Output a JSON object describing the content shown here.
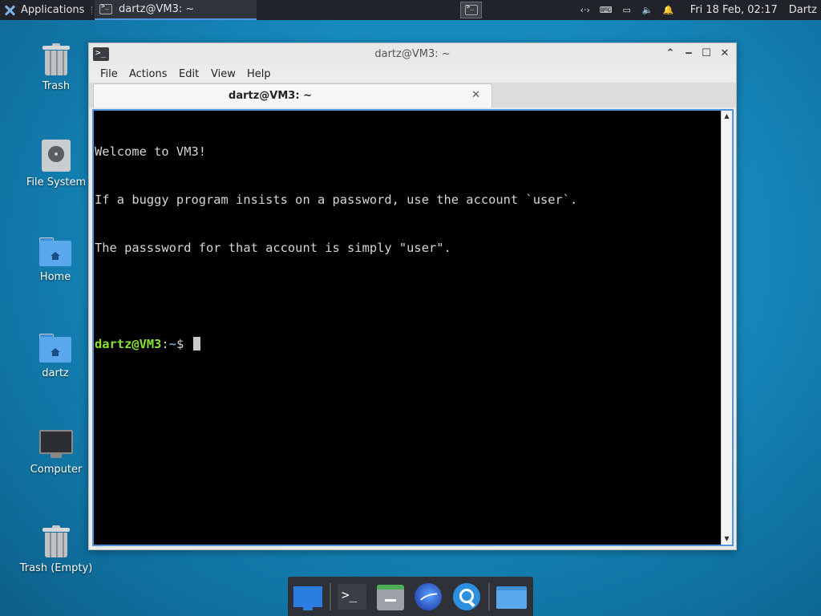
{
  "top_panel": {
    "applications_label": "Applications",
    "task_title": "dartz@VM3: ~",
    "clock": "Fri 18 Feb, 02:17",
    "user": "Dartz",
    "tray_icons": [
      "network-icon",
      "keyboard-icon",
      "display-icon",
      "volume-icon",
      "notification-bell-icon"
    ]
  },
  "desktop": {
    "icons": [
      {
        "label": "Trash",
        "icon": "trash-icon"
      },
      {
        "label": "File System",
        "icon": "drive-icon"
      },
      {
        "label": "Home",
        "icon": "home-folder-icon"
      },
      {
        "label": "dartz",
        "icon": "home-folder-icon"
      },
      {
        "label": "Computer",
        "icon": "computer-icon"
      },
      {
        "label": "Trash (Empty)",
        "icon": "trash-icon"
      }
    ]
  },
  "window": {
    "title": "dartz@VM3: ~",
    "menu": [
      "File",
      "Actions",
      "Edit",
      "View",
      "Help"
    ],
    "tab_title": "dartz@VM3: ~",
    "terminal_lines": [
      "Welcome to VM3!",
      "If a buggy program insists on a password, use the account `user`.",
      "The passsword for that account is simply \"user\".",
      ""
    ],
    "prompt_user_host": "dartz@VM3",
    "prompt_sep": ":",
    "prompt_path": "~",
    "prompt_symbol": "$ "
  },
  "colors": {
    "accent": "#5294e2",
    "prompt_user": "#8ae234",
    "prompt_path": "#729fcf"
  },
  "dock": [
    "show-desktop-icon",
    "terminal-icon",
    "file-manager-icon",
    "web-browser-icon",
    "app-finder-icon",
    "folder-icon"
  ]
}
